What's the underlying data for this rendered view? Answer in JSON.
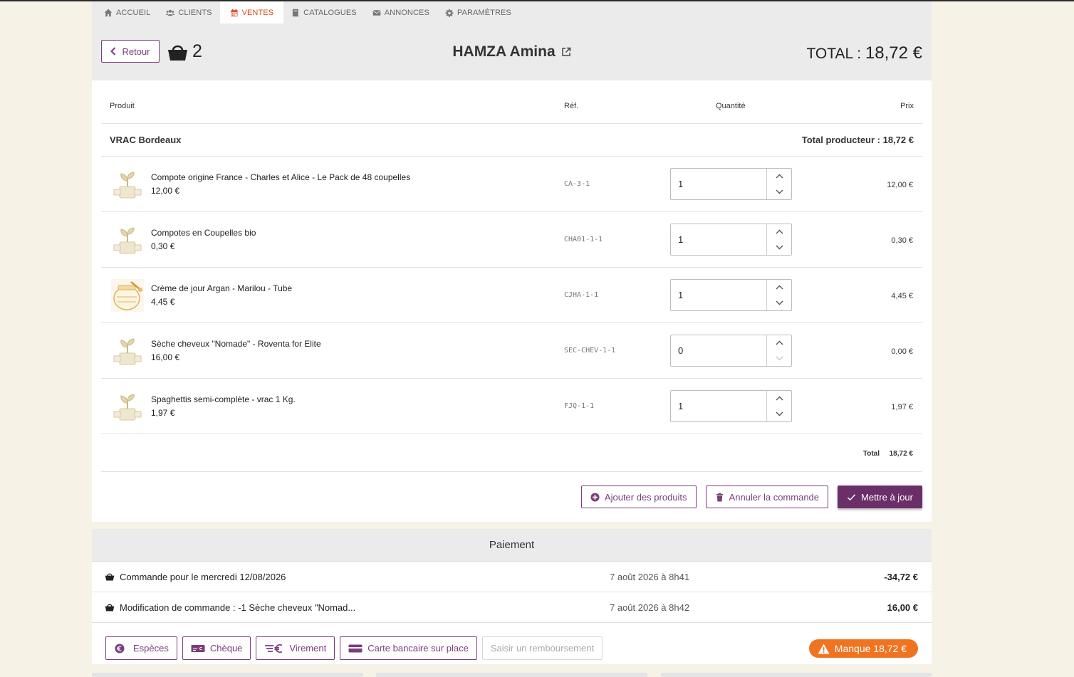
{
  "nav": [
    {
      "label": "ACCUEIL",
      "icon": "home-icon"
    },
    {
      "label": "CLIENTS",
      "icon": "users-icon"
    },
    {
      "label": "VENTES",
      "icon": "calendar-icon",
      "active": true
    },
    {
      "label": "CATALOGUES",
      "icon": "book-icon"
    },
    {
      "label": "ANNONCES",
      "icon": "envelope-icon"
    },
    {
      "label": "PARAMÈTRES",
      "icon": "gear-icon"
    }
  ],
  "header": {
    "back_label": "Retour",
    "basket_count": "2",
    "client_name": "HAMZA Amina",
    "total_label": "TOTAL : ",
    "total_value": "18,72 €"
  },
  "table": {
    "col_product": "Produit",
    "col_ref": "Réf.",
    "col_qty": "Quantité",
    "col_price": "Prix",
    "producer_name": "VRAC Bordeaux",
    "producer_total": "Total producteur : 18,72 €",
    "rows": [
      {
        "name": "Compote origine France - Charles et Alice - Le Pack de 48 coupelles",
        "price": "12,00 €",
        "ref": "CA-3-1",
        "qty": "1",
        "total": "12,00 €",
        "thumb": "plant-pot-icon"
      },
      {
        "name": "Compotes en Coupelles bio",
        "price": "0,30 €",
        "ref": "CHA01-1-1",
        "qty": "1",
        "total": "0,30 €",
        "thumb": "plant-pot-icon"
      },
      {
        "name": "Crème de jour Argan - Marilou - Tube",
        "price": "4,45 €",
        "ref": "CJHA-1-1",
        "qty": "1",
        "total": "4,45 €",
        "thumb": "honey-jar-icon"
      },
      {
        "name": "Sèche cheveux \"Nomade\" - Roventa for Elite",
        "price": "16,00 €",
        "ref": "SEC-CHEV-1-1",
        "qty": "0",
        "total": "0,00 €",
        "thumb": "plant-pot-icon"
      },
      {
        "name": "Spaghettis semi-complète - vrac 1 Kg.",
        "price": "1,97 €",
        "ref": "FJQ-1-1",
        "qty": "1",
        "total": "1,97 €",
        "thumb": "plant-pot-icon"
      }
    ],
    "total_label": "Total",
    "total_value": "18,72 €"
  },
  "actions": {
    "add_products": "Ajouter des produits",
    "cancel_order": "Annuler la commande",
    "update": "Mettre à jour"
  },
  "payment": {
    "title": "Paiement",
    "rows": [
      {
        "label": "Commande pour le mercredi 12/08/2026",
        "date": "7 août 2026 à 8h41",
        "amount": "-34,72 €"
      },
      {
        "label": "Modification de commande : -1 Sèche cheveux \"Nomad...",
        "date": "7 août 2026 à 8h42",
        "amount": "16,00 €"
      }
    ],
    "buttons": {
      "cash": "Espèces",
      "cheque": "Chèque",
      "transfer": "Virement",
      "card": "Carte bancaire sur place",
      "refund": "Saisir un remboursement"
    },
    "missing": "Manque 18,72 €"
  },
  "colors": {
    "accent": "#7d3c7d",
    "active_nav": "#e04b1e",
    "warning": "#f07420"
  }
}
